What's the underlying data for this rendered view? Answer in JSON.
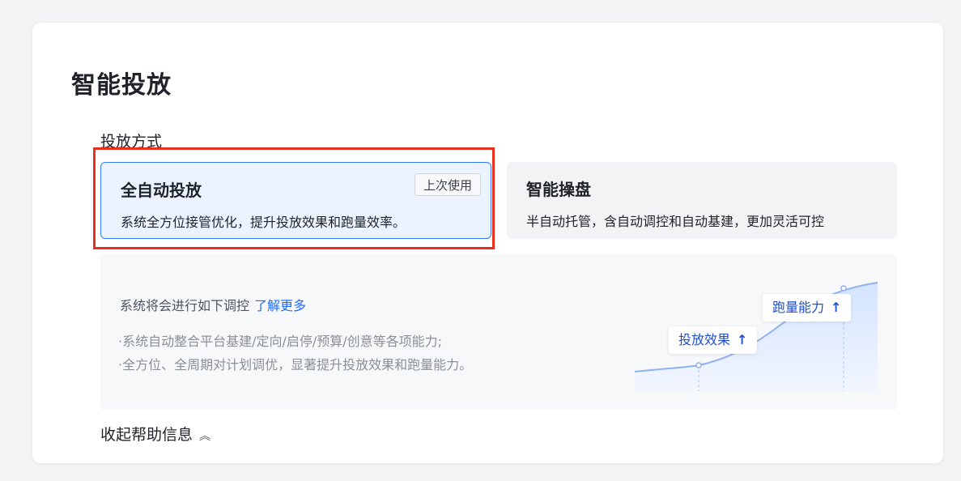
{
  "page": {
    "title": "智能投放"
  },
  "delivery_mode": {
    "section_title": "投放方式",
    "options": [
      {
        "title": "全自动投放",
        "description": "系统全方位接管优化，提升投放效果和跑量效率。",
        "badge": "上次使用",
        "selected": true
      },
      {
        "title": "智能操盘",
        "description": "半自动托管，含自动调控和自动基建，更加灵活可控",
        "selected": false
      }
    ]
  },
  "help": {
    "heading": "系统将会进行如下调控",
    "learn_more": "了解更多",
    "lines": [
      "·系统自动整合平台基建/定向/启停/预算/创意等各项能力;",
      "·全方位、全周期对计划调优，显著提升投放效果和跑量能力。"
    ],
    "illustration": {
      "tag_effect": "投放效果",
      "tag_volume": "跑量能力",
      "arrow": "↑"
    },
    "collapse_label": "收起帮助信息",
    "collapse_icon": "chevron-double-up-icon"
  },
  "colors": {
    "accent": "#1f6bff",
    "highlight_frame": "#e8301c",
    "selected_bg": "#eaf3ff"
  }
}
